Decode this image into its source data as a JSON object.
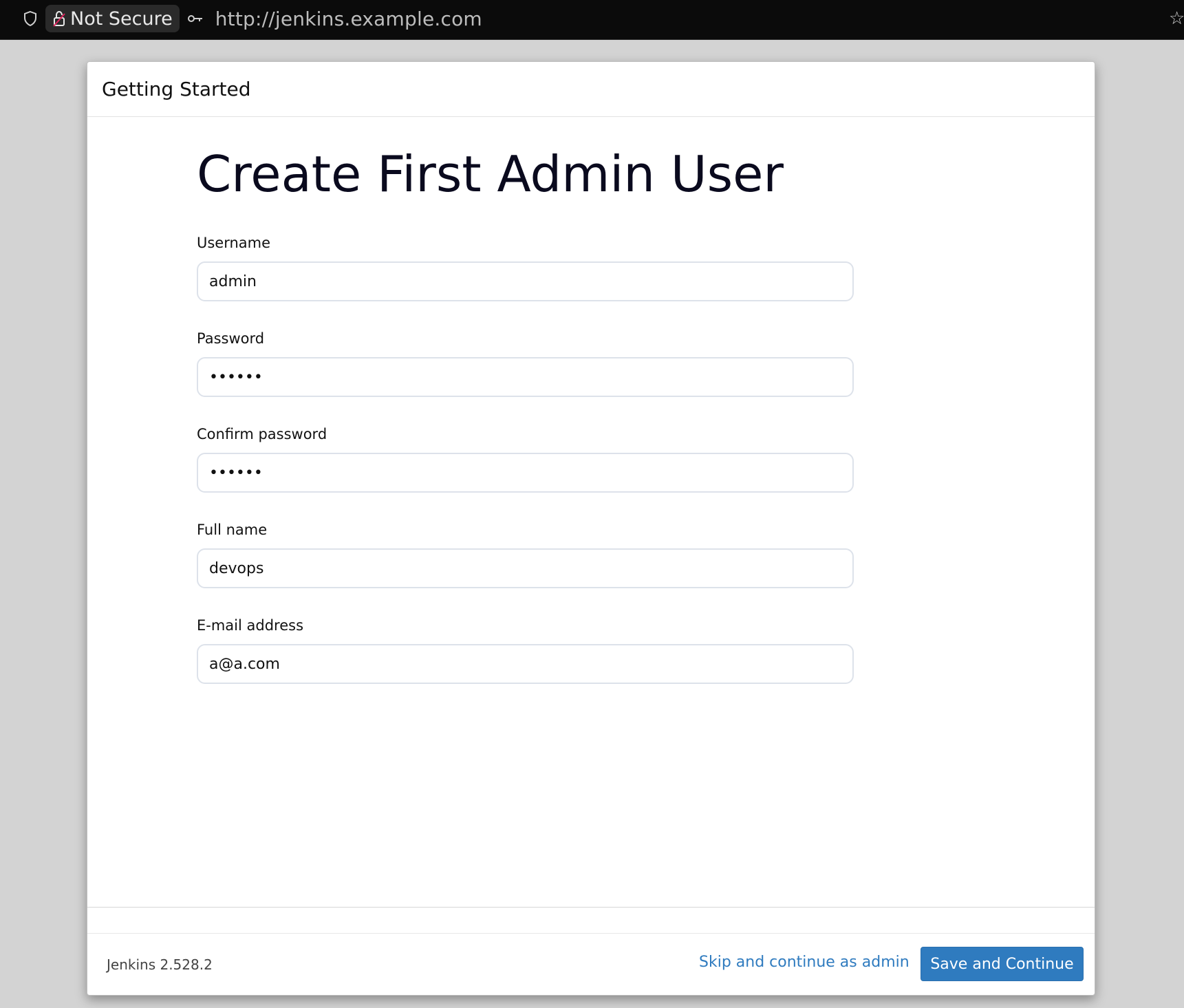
{
  "browser": {
    "security_label": "Not Secure",
    "url": "http://jenkins.example.com"
  },
  "dialog": {
    "header_title": "Getting Started",
    "page_title": "Create First Admin User",
    "fields": [
      {
        "label": "Username",
        "value": "admin",
        "type": "text"
      },
      {
        "label": "Password",
        "value": "••••••",
        "type": "password"
      },
      {
        "label": "Confirm password",
        "value": "••••••",
        "type": "password"
      },
      {
        "label": "Full name",
        "value": "devops",
        "type": "text"
      },
      {
        "label": "E-mail address",
        "value": "a@a.com",
        "type": "text"
      }
    ]
  },
  "footer": {
    "version": "Jenkins 2.528.2",
    "skip_label": "Skip and continue as admin",
    "save_label": "Save and Continue"
  },
  "colors": {
    "primary": "#2f7bbf",
    "browser_bar": "#0b0b0b",
    "backdrop": "#d3d3d3"
  }
}
